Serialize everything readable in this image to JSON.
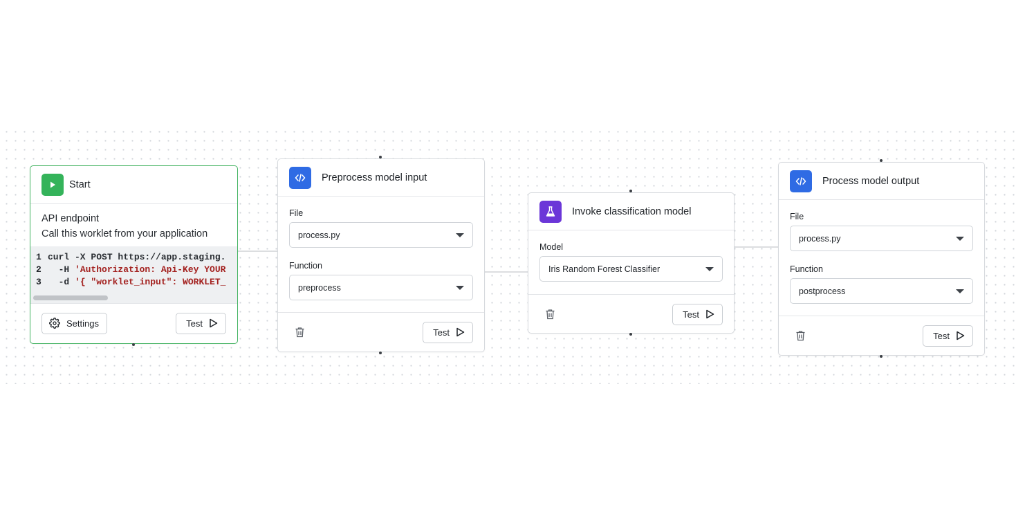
{
  "nodes": {
    "start": {
      "title": "Start",
      "section_title": "API endpoint",
      "section_subtitle": "Call this worklet from your application",
      "code_lines": [
        {
          "num": "1",
          "parts": [
            "curl -X POST https://app.staging.",
            ""
          ]
        },
        {
          "num": "2",
          "parts": [
            "  -H ",
            "'Authorization: Api-Key YOUR"
          ]
        },
        {
          "num": "3",
          "parts": [
            "  -d ",
            "'{ \"worklet_input\": WORKLET_"
          ]
        }
      ],
      "settings_label": "Settings",
      "test_label": "Test",
      "icon": "play-icon"
    },
    "preprocess": {
      "title": "Preprocess model input",
      "file_label": "File",
      "file_value": "process.py",
      "function_label": "Function",
      "function_value": "preprocess",
      "test_label": "Test",
      "icon": "code-icon"
    },
    "invoke": {
      "title": "Invoke classification model",
      "model_label": "Model",
      "model_value": "Iris Random Forest Classifier",
      "test_label": "Test",
      "icon": "flask-icon"
    },
    "postprocess": {
      "title": "Process model output",
      "file_label": "File",
      "file_value": "process.py",
      "function_label": "Function",
      "function_value": "postprocess",
      "test_label": "Test",
      "icon": "code-icon"
    }
  },
  "colors": {
    "start_border": "#45b463",
    "green": "#34b35a",
    "blue": "#2f6be4",
    "purple": "#6b36d8",
    "code_red": "#a3211f"
  }
}
